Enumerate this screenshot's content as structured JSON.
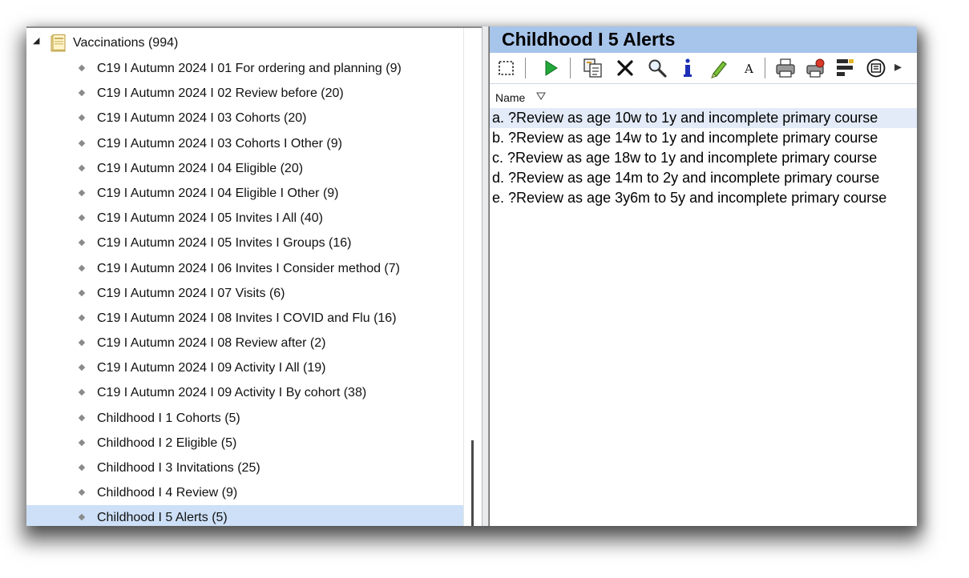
{
  "tree": {
    "root": {
      "label": "Vaccinations (994)",
      "icon": "folder-icon"
    },
    "items": [
      {
        "label": "C19 I Autumn 2024 I 01 For ordering and planning (9)"
      },
      {
        "label": "C19 I Autumn 2024 I 02 Review before (20)"
      },
      {
        "label": "C19 I Autumn 2024 I 03 Cohorts (20)"
      },
      {
        "label": "C19 I Autumn 2024 I 03 Cohorts I Other (9)"
      },
      {
        "label": "C19 I Autumn 2024 I 04 Eligible (20)"
      },
      {
        "label": "C19 I Autumn 2024 I 04 Eligible I Other (9)"
      },
      {
        "label": "C19 I Autumn 2024 I 05 Invites I All (40)"
      },
      {
        "label": "C19 I Autumn 2024 I 05 Invites I Groups (16)"
      },
      {
        "label": "C19 I Autumn 2024 I 06 Invites I Consider method (7)"
      },
      {
        "label": "C19 I Autumn 2024 I 07 Visits (6)"
      },
      {
        "label": "C19 I Autumn 2024 I 08 Invites I COVID and Flu (16)"
      },
      {
        "label": "C19 I Autumn 2024 I 08 Review after (2)"
      },
      {
        "label": "C19 I Autumn 2024 I 09 Activity I All (19)"
      },
      {
        "label": "C19 I Autumn 2024 I 09 Activity I By cohort (38)"
      },
      {
        "label": "Childhood I 1 Cohorts (5)"
      },
      {
        "label": "Childhood I 2 Eligible (5)"
      },
      {
        "label": "Childhood I 3 Invitations (25)"
      },
      {
        "label": "Childhood I 4 Review (9)"
      },
      {
        "label": "Childhood I 5 Alerts (5)",
        "selected": true
      }
    ]
  },
  "panel": {
    "title": "Childhood I 5 Alerts",
    "toolbar": [
      {
        "icon": "select-icon"
      },
      {
        "icon": "run-icon"
      },
      {
        "icon": "copy-icon"
      },
      {
        "icon": "delete-icon"
      },
      {
        "icon": "search-icon"
      },
      {
        "icon": "info-icon"
      },
      {
        "icon": "edit-icon"
      },
      {
        "icon": "font-icon"
      },
      {
        "icon": "print-icon"
      },
      {
        "icon": "print-preview-icon"
      },
      {
        "icon": "report-icon"
      },
      {
        "icon": "export-icon"
      }
    ],
    "column_header": "Name",
    "rows": [
      {
        "label": "a. ?Review as age 10w to 1y and incomplete primary course",
        "selected": true
      },
      {
        "label": "b. ?Review as age 14w to 1y and incomplete primary course"
      },
      {
        "label": "c. ?Review as age 18w to 1y and incomplete primary course"
      },
      {
        "label": "d. ?Review as age 14m to 2y and incomplete primary course"
      },
      {
        "label": "e. ?Review as age 3y6m to 5y and incomplete primary course"
      }
    ]
  },
  "colors": {
    "title_bar": "#a7c4ea",
    "tree_selected": "#cde0f7",
    "row_selected": "#e2ebf7"
  }
}
